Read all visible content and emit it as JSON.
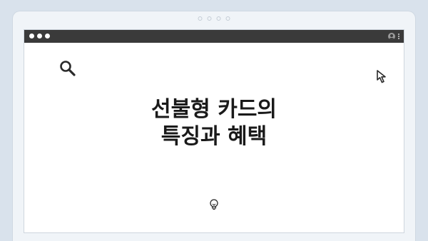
{
  "headline": {
    "line1": "선불형 카드의",
    "line2": "특징과 혜택"
  },
  "icons": {
    "search": "search-icon",
    "cursor": "cursor-icon",
    "lightbulb": "lightbulb-icon",
    "profile": "profile-icon",
    "menu": "kebab-menu-icon"
  },
  "colors": {
    "background": "#d9e2ec",
    "titlebar": "#3a3a3a",
    "text": "#1a1a1a"
  }
}
